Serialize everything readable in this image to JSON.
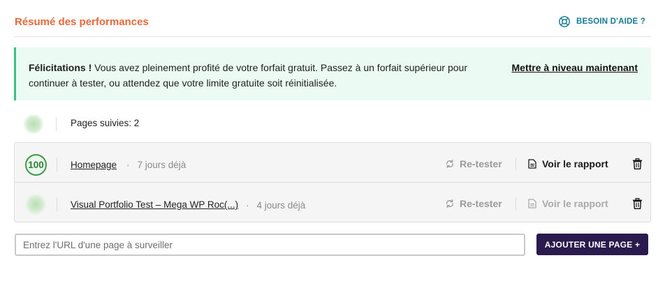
{
  "header": {
    "title": "Résumé des performances",
    "help_label": "BESOIN D'AIDE ?",
    "help_icon": "lifebuoy-icon"
  },
  "notice": {
    "strong_text": "Félicitations !",
    "body_text": " Vous avez pleinement profité de votre forfait gratuit. Passez à un forfait supérieur pour continuer à tester, ou attendez que votre limite gratuite soit réinitialisée.",
    "cta_label": "Mettre à niveau maintenant",
    "accent_color": "#3fc081"
  },
  "summary": {
    "pages_tracked": "Pages suivies: 2"
  },
  "pages": [
    {
      "score": "100",
      "name": "Homepage",
      "separator": "·",
      "age": "7 jours déjà",
      "retest_label": "Re-tester",
      "report_label": "Voir le rapport",
      "report_enabled": true
    },
    {
      "score": "",
      "name": "Visual Portfolio Test – Mega WP Roc(...)",
      "separator": "·",
      "age": "4 jours déjà",
      "retest_label": "Re-tester",
      "report_label": "Voir le rapport",
      "report_enabled": false
    }
  ],
  "add_form": {
    "placeholder": "Entrez l'URL d'une page à surveiller",
    "value": "",
    "button_label": "AJOUTER UNE PAGE +"
  },
  "colors": {
    "title": "#e8683a",
    "help": "#157a93",
    "score_good": "#3c9b48",
    "button_bg": "#2b1a4d"
  }
}
